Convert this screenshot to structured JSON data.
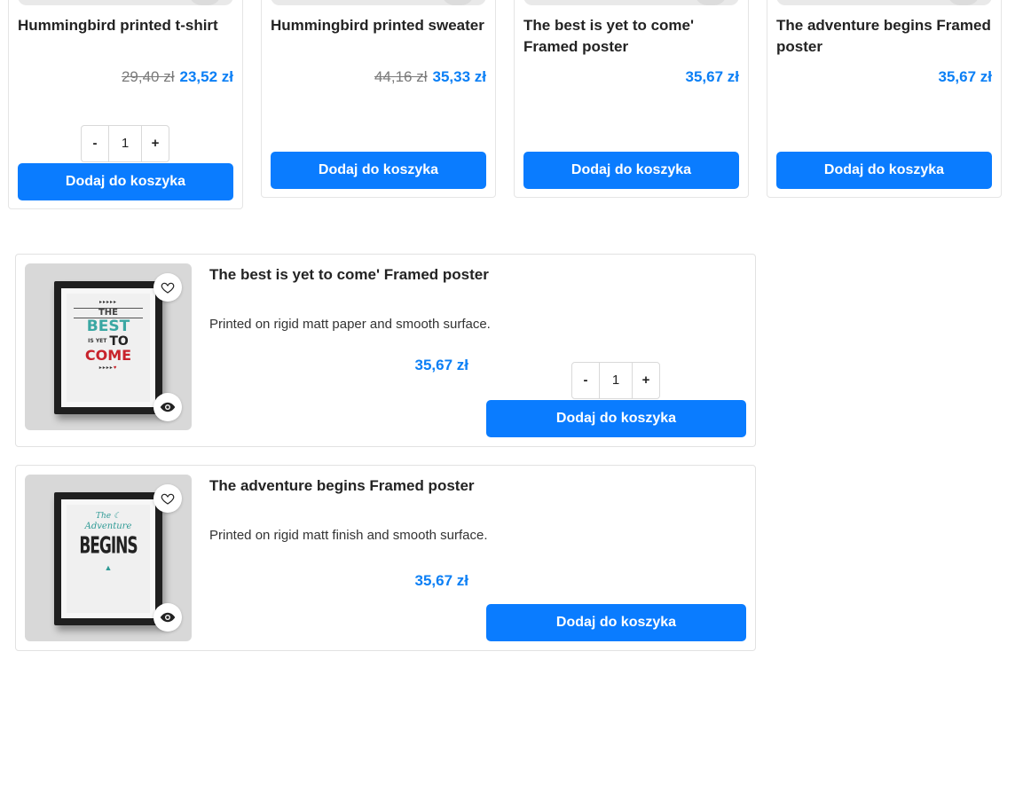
{
  "currency_note": "zł",
  "colors": {
    "accent": "#0a7cff",
    "price": "#0b7ff5",
    "old_price": "#7a7a7a"
  },
  "grid_products": [
    {
      "title": "Hummingbird printed t-shirt",
      "old_price": "29,40 zł",
      "price": "23,52 zł",
      "qty": "1",
      "cart_label": "Dodaj do koszyka",
      "qty_minus": "-",
      "qty_plus": "+"
    },
    {
      "title": "Hummingbird printed sweater",
      "old_price": "44,16 zł",
      "price": "35,33 zł",
      "cart_label": "Dodaj do koszyka"
    },
    {
      "title": "The best is yet to come' Framed poster",
      "price": "35,67 zł",
      "cart_label": "Dodaj do koszyka"
    },
    {
      "title": "The adventure begins Framed poster",
      "price": "35,67 zł",
      "cart_label": "Dodaj do koszyka"
    }
  ],
  "list_products": [
    {
      "title": "The best is yet to come' Framed poster",
      "description": "Printed on rigid matt paper and smooth surface.",
      "price": "35,67 zł",
      "qty": "1",
      "qty_minus": "-",
      "qty_plus": "+",
      "cart_label": "Dodaj do koszyka",
      "image_icon": "poster-best-yet-to-come",
      "poster_text": {
        "l1": "THE",
        "l2": "BEST",
        "l3": "IS YET",
        "l4": "TO",
        "l5": "COME"
      }
    },
    {
      "title": "The adventure begins Framed poster",
      "description": "Printed on rigid matt finish and smooth surface.",
      "price": "35,67 zł",
      "cart_label": "Dodaj do koszyka",
      "image_icon": "poster-adventure-begins",
      "poster_text": {
        "l1": "The",
        "l2": "Adventure",
        "l3": "BEGINS"
      }
    }
  ],
  "icons": {
    "wishlist": "heart-icon",
    "quickview": "eye-icon"
  }
}
